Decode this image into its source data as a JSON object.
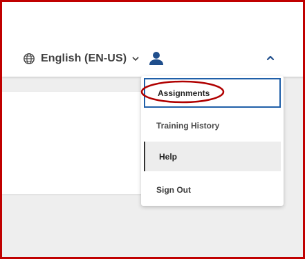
{
  "header": {
    "language_label": "English (EN-US)",
    "language_icon": "globe-icon",
    "language_chevron_icon": "chevron-down-icon",
    "user_icon": "user-icon",
    "collapse_icon": "chevron-up-icon"
  },
  "dropdown": {
    "items": [
      {
        "label": "Assignments",
        "state": "focused"
      },
      {
        "label": "Training History",
        "state": "default"
      },
      {
        "label": "Help",
        "state": "hovered"
      },
      {
        "label": "Sign Out",
        "state": "default"
      }
    ]
  },
  "colors": {
    "frame_border": "#c00000",
    "accent_blue": "#1f4e8c",
    "focus_border": "#1f5fa8",
    "annotation_red": "#b00000",
    "background": "#eeeeee"
  }
}
